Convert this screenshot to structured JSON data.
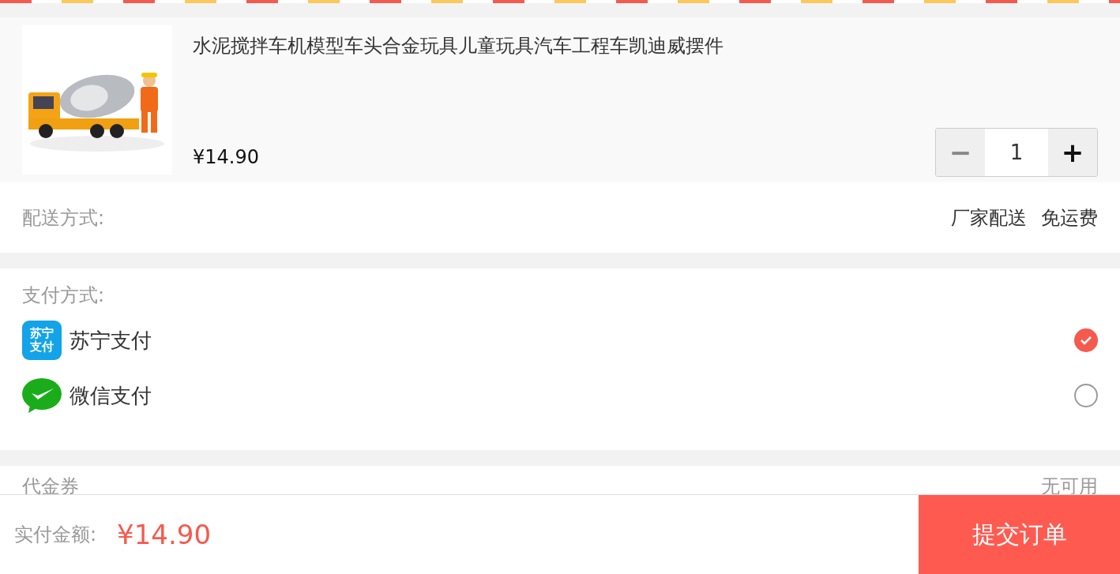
{
  "product": {
    "kind": "picture",
    "title": "水泥搅拌车机模型车头合金玩具儿童玩具汽车工程车凯迪威摆件",
    "price": "¥14.90",
    "quantity": "1",
    "minus": "−",
    "plus": "+"
  },
  "delivery": {
    "label": "配送方式:",
    "method": "厂家配送",
    "fee": "免运费"
  },
  "payment": {
    "label": "支付方式:",
    "options": [
      {
        "kind": "suning",
        "name": "苏宁支付",
        "logo_lines": [
          "苏宁",
          "支付"
        ],
        "selected": true
      },
      {
        "kind": "wechat",
        "name": "微信支付",
        "selected": false
      }
    ]
  },
  "coupon": {
    "label": "代金券",
    "value": "无可用"
  },
  "footer": {
    "label": "实付金额:",
    "total": "¥14.90",
    "submit": "提交订单"
  }
}
